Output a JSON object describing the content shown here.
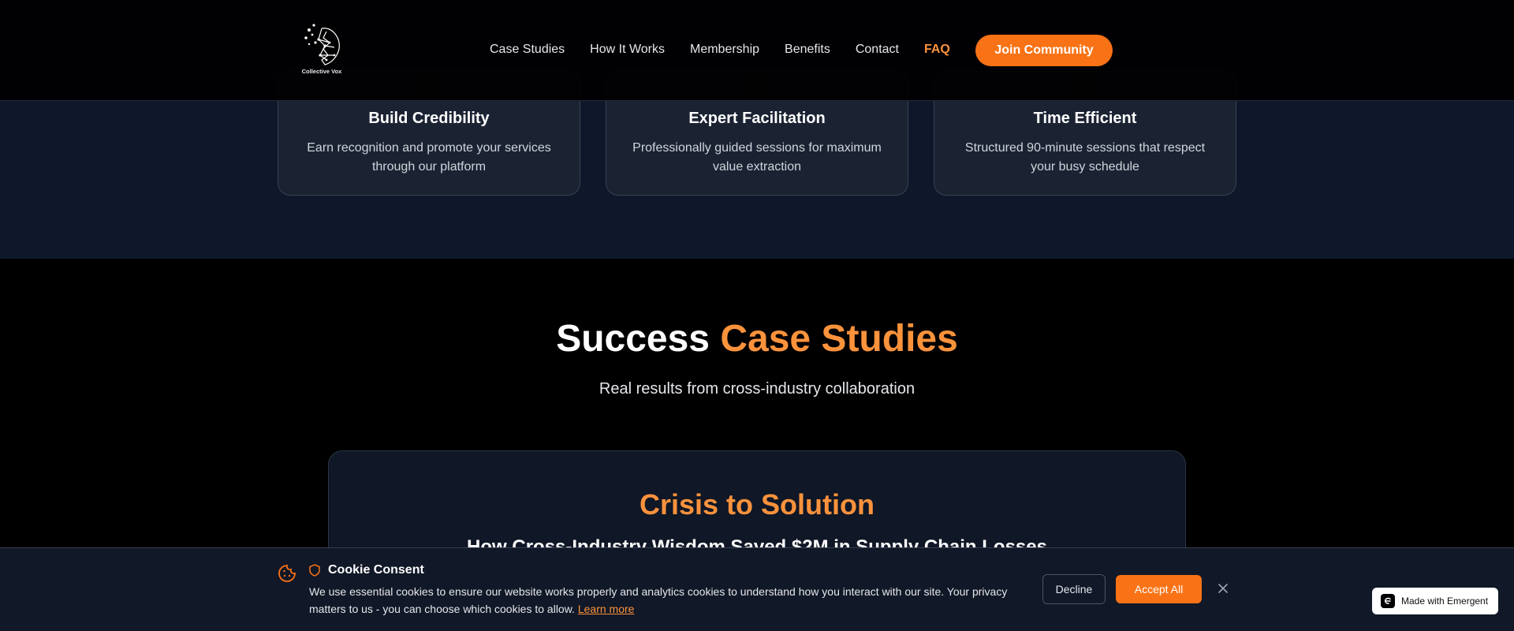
{
  "header": {
    "logo_text": "Collective Vox",
    "nav": [
      {
        "label": "Case Studies"
      },
      {
        "label": "How It Works"
      },
      {
        "label": "Membership"
      },
      {
        "label": "Benefits"
      },
      {
        "label": "Contact"
      },
      {
        "label": "FAQ",
        "active": true
      }
    ],
    "join_label": "Join Community"
  },
  "features": [
    {
      "title": "Build Credibility",
      "desc": "Earn recognition and promote your services through our platform"
    },
    {
      "title": "Expert Facilitation",
      "desc": "Professionally guided sessions for maximum value extraction"
    },
    {
      "title": "Time Efficient",
      "desc": "Structured 90-minute sessions that respect your busy schedule"
    }
  ],
  "case_studies": {
    "heading_plain": "Success",
    "heading_accent": "Case Studies",
    "subtitle": "Real results from cross-industry collaboration",
    "card_title": "Crisis to Solution",
    "card_subtitle": "How Cross-Industry Wisdom Saved $2M in Supply Chain Losses"
  },
  "cookie": {
    "title": "Cookie Consent",
    "text": "We use essential cookies to ensure our website works properly and analytics cookies to understand how you interact with our site. Your privacy matters to us - you can choose which cookies to allow.",
    "learn_more": "Learn more",
    "decline_label": "Decline",
    "accept_label": "Accept All"
  },
  "badge": {
    "label": "Made with Emergent"
  },
  "colors": {
    "accent": "#f97316",
    "accent_text": "#fb923c",
    "bg": "#000000",
    "band": "#0f172a"
  }
}
